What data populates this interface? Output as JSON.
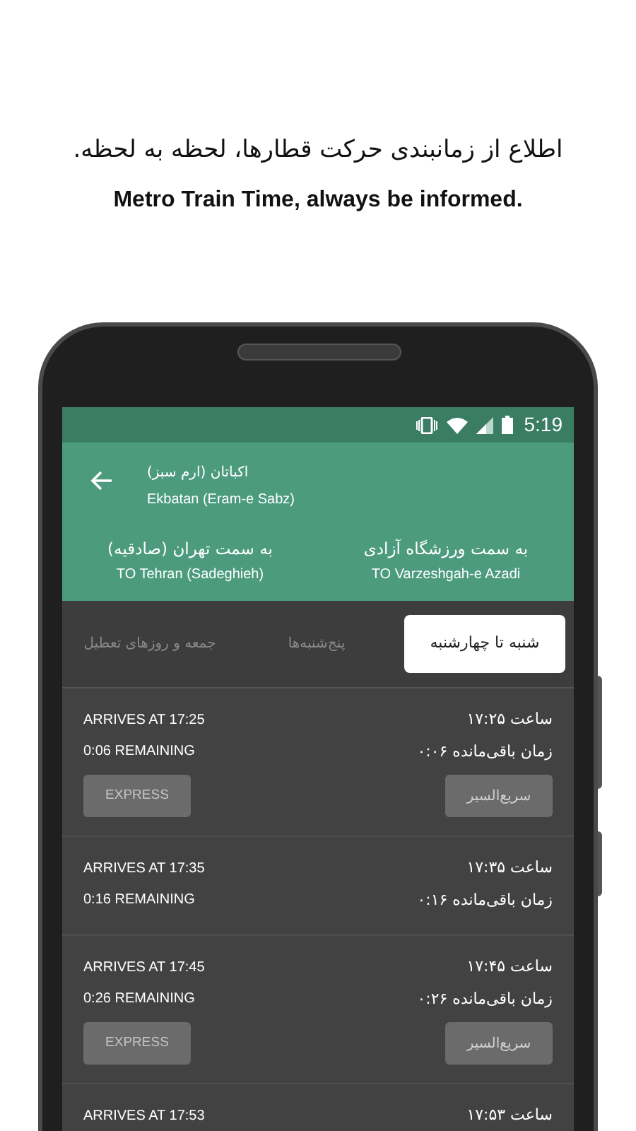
{
  "headline_fa": "اطلاع از زمانبندی حرکت قطارها، لحظه به لحظه.",
  "headline_en": "Metro Train Time, always be informed.",
  "status_bar": {
    "time": "5:19"
  },
  "station": {
    "name_fa": "اکباتان (ارم سبز)",
    "name_en": "Ekbatan (Eram-e Sabz)"
  },
  "directions": [
    {
      "label_fa": "به سمت ورزشگاه آزادی",
      "label_en": "TO Varzeshgah-e Azadi"
    },
    {
      "label_fa": "به سمت تهران (صادقیه)",
      "label_en": "TO Tehran (Sadeghieh)"
    }
  ],
  "day_tabs": [
    {
      "label": "شنبه تا چهارشنبه",
      "selected": true
    },
    {
      "label": "پنج‌شنبه‌ها",
      "selected": false
    },
    {
      "label": "جمعه و روزهای تعطیل",
      "selected": false
    }
  ],
  "trains": [
    {
      "time_fa": "ساعت ۱۷:۲۵",
      "arrives_en": "ARRIVES AT 17:25",
      "remaining_fa": "زمان باقی‌مانده ۰:۰۶",
      "remaining_en": "0:06 REMAINING",
      "express": true,
      "express_fa": "سریع‌السیر",
      "express_en": "EXPRESS"
    },
    {
      "time_fa": "ساعت ۱۷:۳۵",
      "arrives_en": "ARRIVES AT 17:35",
      "remaining_fa": "زمان باقی‌مانده ۰:۱۶",
      "remaining_en": "0:16 REMAINING",
      "express": false
    },
    {
      "time_fa": "ساعت ۱۷:۴۵",
      "arrives_en": "ARRIVES AT 17:45",
      "remaining_fa": "زمان باقی‌مانده ۰:۲۶",
      "remaining_en": "0:26 REMAINING",
      "express": true,
      "express_fa": "سریع‌السیر",
      "express_en": "EXPRESS"
    },
    {
      "time_fa": "ساعت ۱۷:۵۳",
      "arrives_en": "ARRIVES AT 17:53",
      "express": false
    }
  ]
}
